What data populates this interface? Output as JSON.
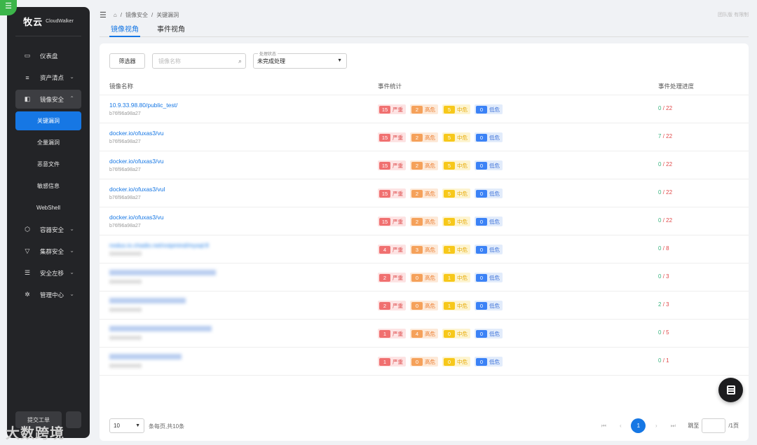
{
  "app": {
    "logo_cn": "牧云",
    "logo_en": "CloudWalker"
  },
  "sidebar": {
    "items": [
      {
        "label": "仪表盘",
        "icon": "dashboard-icon"
      },
      {
        "label": "资产清点",
        "icon": "server-icon"
      },
      {
        "label": "镜像安全",
        "icon": "image-icon"
      },
      {
        "label": "容器安全",
        "icon": "cube-icon"
      },
      {
        "label": "集群安全",
        "icon": "cluster-icon"
      },
      {
        "label": "安全左移",
        "icon": "shift-left-icon"
      },
      {
        "label": "管理中心",
        "icon": "gear-icon"
      }
    ],
    "sub_items": [
      "关键漏洞",
      "全量漏洞",
      "恶意文件",
      "敏感信息",
      "WebShell"
    ],
    "ticket_label": "提交工单"
  },
  "breadcrumb": {
    "item1": "镜像安全",
    "item2": "关键漏洞",
    "sep": "/"
  },
  "user_label": "团队版 有限制",
  "tabs": [
    "镜像视角",
    "事件视角"
  ],
  "filters": {
    "button": "筛选器",
    "search_placeholder": "镜像名称",
    "status_label": "处理状态",
    "status_value": "未完成处理"
  },
  "table": {
    "headers": [
      "镜像名称",
      "事件统计",
      "事件处理进度"
    ],
    "badge_labels": {
      "severe": "严重",
      "high": "高危",
      "medium": "中危",
      "low": "低危"
    },
    "rows": [
      {
        "name": "10.9.33.98.80/public_test/",
        "hash": "b76f96a98a27",
        "severe": "15",
        "high": "2",
        "medium": "5",
        "low": "0",
        "done": "0",
        "total": "/ 22"
      },
      {
        "name": "docker.io/ofuxas3/vu",
        "hash": "b76f96a98a27",
        "severe": "15",
        "high": "2",
        "medium": "5",
        "low": "0",
        "done": "7",
        "total": "/ 22"
      },
      {
        "name": "docker.io/ofuxas3/vu",
        "hash": "b76f96a98a27",
        "severe": "15",
        "high": "2",
        "medium": "5",
        "low": "0",
        "done": "0",
        "total": "/ 22"
      },
      {
        "name": "docker.io/ofuxas3/vul",
        "hash": "b76f96a98a27",
        "severe": "15",
        "high": "2",
        "medium": "5",
        "low": "0",
        "done": "0",
        "total": "/ 22"
      },
      {
        "name": "docker.io/ofuxas3/vu",
        "hash": "b76f96a98a27",
        "severe": "15",
        "high": "2",
        "medium": "5",
        "low": "0",
        "done": "0",
        "total": "/ 22"
      },
      {
        "name": "nodus.io.chadio.net/voipmind/mysql:8",
        "hash": "",
        "severe": "4",
        "high": "3",
        "medium": "1",
        "low": "0",
        "done": "0",
        "total": "/ 8"
      },
      {
        "name": "",
        "hash": "",
        "severe": "2",
        "high": "0",
        "medium": "1",
        "low": "0",
        "done": "0",
        "total": "/ 3"
      },
      {
        "name": "",
        "hash": "",
        "severe": "2",
        "high": "0",
        "medium": "1",
        "low": "0",
        "done": "2",
        "total": "/ 3"
      },
      {
        "name": "",
        "hash": "",
        "severe": "1",
        "high": "4",
        "medium": "0",
        "low": "0",
        "done": "0",
        "total": "/ 5"
      },
      {
        "name": "",
        "hash": "",
        "severe": "1",
        "high": "0",
        "medium": "0",
        "low": "0",
        "done": "0",
        "total": "/ 1"
      }
    ]
  },
  "pagination": {
    "page_size": "10",
    "summary": "条每页,共10条",
    "current_page": "1",
    "jump_label": "跳至",
    "pages_suffix": "/1页"
  },
  "watermark": "大数跨境"
}
